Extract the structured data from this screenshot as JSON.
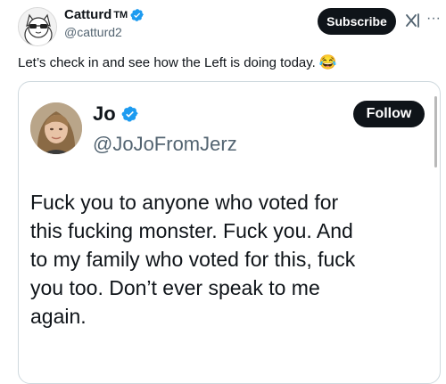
{
  "outer_tweet": {
    "display_name": "Catturd",
    "tm": "TM",
    "handle": "@catturd2",
    "subscribe_label": "Subscribe",
    "more_label": "···",
    "text": "Let’s check in and see how the Left is doing today.",
    "emoji": "😂"
  },
  "quoted_tweet": {
    "display_name": "Jo",
    "handle": "@JoJoFromJerz",
    "follow_label": "Follow",
    "body_lines": [
      "Fuck you to anyone who voted for",
      "this fucking monster. Fuck you. And",
      "to my family who voted for this, fuck",
      "you too. Don’t ever speak to me",
      "again."
    ]
  },
  "icons": {
    "verified": "verified-badge-icon",
    "grok": "grok-icon",
    "more": "more-icon"
  },
  "colors": {
    "verified_blue": "#1d9bf0",
    "button_dark": "#0f1419",
    "secondary_text": "#536471",
    "card_border": "#cfd9de"
  }
}
